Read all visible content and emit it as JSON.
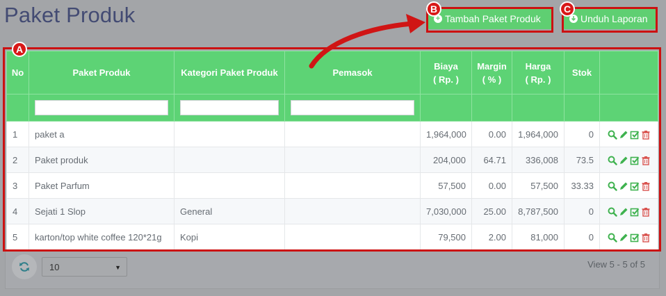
{
  "page": {
    "title": "Paket Produk"
  },
  "toolbar": {
    "add_label": "Tambah Paket Produk",
    "download_label": "Unduh Laporan"
  },
  "annotations": {
    "a": "A",
    "b": "B",
    "c": "C"
  },
  "colors": {
    "header": "#5dd375",
    "highlight": "#cc1111",
    "title": "#434b73"
  },
  "table": {
    "columns": [
      {
        "key": "no",
        "label": "No"
      },
      {
        "key": "name",
        "label": "Paket Produk"
      },
      {
        "key": "category",
        "label": "Kategori Paket Produk"
      },
      {
        "key": "supplier",
        "label": "Pemasok"
      },
      {
        "key": "cost",
        "label": "Biaya",
        "sub": "( Rp. )"
      },
      {
        "key": "margin",
        "label": "Margin",
        "sub": "( % )"
      },
      {
        "key": "price",
        "label": "Harga",
        "sub": "( Rp. )"
      },
      {
        "key": "stock",
        "label": "Stok"
      },
      {
        "key": "actions",
        "label": ""
      }
    ],
    "rows": [
      {
        "no": "1",
        "name": "paket a",
        "category": "",
        "supplier": "",
        "cost": "1,964,000",
        "margin": "0.00",
        "price": "1,964,000",
        "stock": "0"
      },
      {
        "no": "2",
        "name": "Paket produk",
        "category": "",
        "supplier": "",
        "cost": "204,000",
        "margin": "64.71",
        "price": "336,008",
        "stock": "73.5"
      },
      {
        "no": "3",
        "name": "Paket Parfum",
        "category": "",
        "supplier": "",
        "cost": "57,500",
        "margin": "0.00",
        "price": "57,500",
        "stock": "33.33"
      },
      {
        "no": "4",
        "name": "Sejati 1 Slop",
        "category": "General",
        "supplier": "",
        "cost": "7,030,000",
        "margin": "25.00",
        "price": "8,787,500",
        "stock": "0"
      },
      {
        "no": "5",
        "name": "karton/top white coffee 120*21g",
        "category": "Kopi",
        "supplier": "",
        "cost": "79,500",
        "margin": "2.00",
        "price": "81,000",
        "stock": "0"
      }
    ],
    "row_actions": [
      "search-icon",
      "pencil-icon",
      "check-square-icon",
      "trash-icon"
    ]
  },
  "pager": {
    "page_size": "10",
    "view_info": "View 5 - 5 of 5"
  }
}
